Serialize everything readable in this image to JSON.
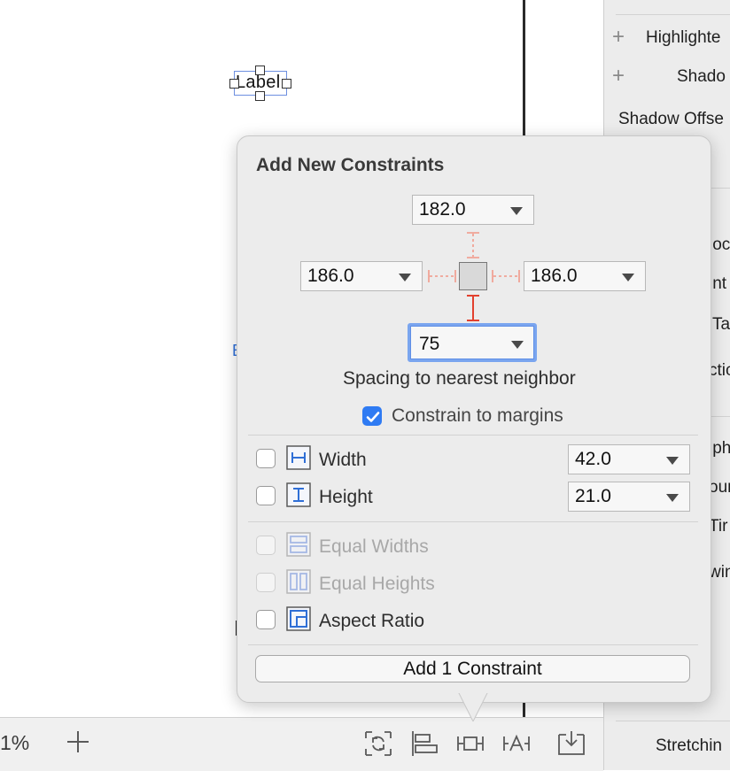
{
  "canvas": {
    "label_text": "Label",
    "stray_text": "E"
  },
  "inspector": {
    "items": [
      {
        "label": "Highlighte",
        "has_plus": true
      },
      {
        "label": "Shado",
        "has_plus": true
      },
      {
        "label": "Shadow Offse",
        "has_plus": false
      },
      {
        "label": "ioc"
      },
      {
        "label": "int"
      },
      {
        "label": "Ta"
      },
      {
        "label": "ctic"
      },
      {
        "label": "lph"
      },
      {
        "label": "oun"
      },
      {
        "label": "Tir"
      },
      {
        "label": "win"
      },
      {
        "label": "Stretchin"
      }
    ]
  },
  "bottombar": {
    "zoom_label": "1%",
    "add_icon": "plus-icon",
    "tools": [
      "update-frames-icon",
      "align-icon",
      "add-constraints-icon",
      "resolve-issues-icon",
      "embed-in-icon"
    ]
  },
  "popover": {
    "title": "Add New Constraints",
    "top_value": "182.0",
    "left_value": "186.0",
    "right_value": "186.0",
    "bottom_value": "75",
    "spacing_caption": "Spacing to nearest neighbor",
    "constrain_margins": {
      "label": "Constrain to margins",
      "checked": true
    },
    "width": {
      "label": "Width",
      "value": "42.0",
      "checked": false
    },
    "height": {
      "label": "Height",
      "value": "21.0",
      "checked": false
    },
    "equal_widths": {
      "label": "Equal Widths",
      "enabled": false
    },
    "equal_heights": {
      "label": "Equal Heights",
      "enabled": false
    },
    "aspect_ratio": {
      "label": "Aspect Ratio",
      "checked": false
    },
    "add_button": "Add 1 Constraint"
  },
  "colors": {
    "accent": "#2f7bf3",
    "constraint_active": "#e2412f",
    "constraint_inactive": "#f0a395",
    "focus_ring": "#7aa5ef"
  }
}
